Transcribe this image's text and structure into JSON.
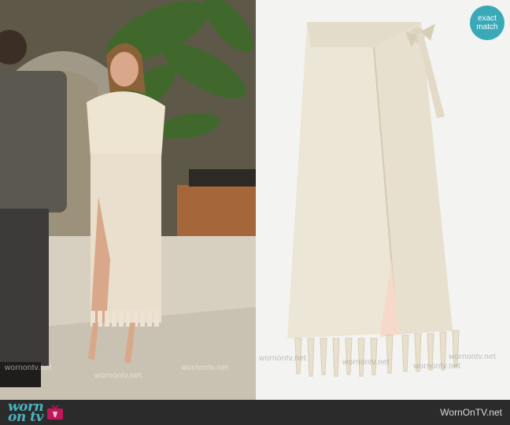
{
  "badge": {
    "line1": "exact",
    "line2": "match"
  },
  "footer": {
    "logo_line1": "worn",
    "logo_line2": "on tv",
    "site": "WornOnTV.net"
  },
  "watermark": "wornontv.net",
  "colors": {
    "accent": "#3aa9b7",
    "footer_bg": "#2b2b2b"
  },
  "icons": {
    "logo": "tv-icon"
  }
}
